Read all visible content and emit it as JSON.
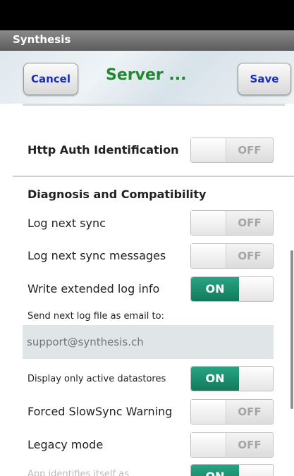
{
  "app": {
    "title": "Synthesis"
  },
  "toolbar": {
    "cancel_label": "Cancel",
    "title": "Server ...",
    "save_label": "Save"
  },
  "http_auth": {
    "label": "Http Auth Identification",
    "state": "OFF"
  },
  "section": {
    "title": "Diagnosis and Compatibility"
  },
  "settings": {
    "log_next_sync": {
      "label": "Log next sync",
      "state": "OFF"
    },
    "log_next_sync_messages": {
      "label": "Log next sync messages",
      "state": "OFF"
    },
    "write_extended_log": {
      "label": "Write extended log info",
      "state": "ON"
    },
    "send_log": {
      "label": "Send next log file as email to:",
      "value": "support@synthesis.ch"
    },
    "display_active_datastores": {
      "label": "Display only active datastores",
      "state": "ON"
    },
    "forced_slowsync": {
      "label": "Forced SlowSync Warning",
      "state": "OFF"
    },
    "legacy_mode": {
      "label": "Legacy mode",
      "state": "OFF"
    },
    "app_identifies": {
      "label": "App identifies itself as",
      "state": "ON"
    }
  },
  "colors": {
    "accent_on": "#1a8f6e",
    "toolbar_button_text": "#1a2eb8",
    "toolbar_title": "#1f8a2b"
  }
}
